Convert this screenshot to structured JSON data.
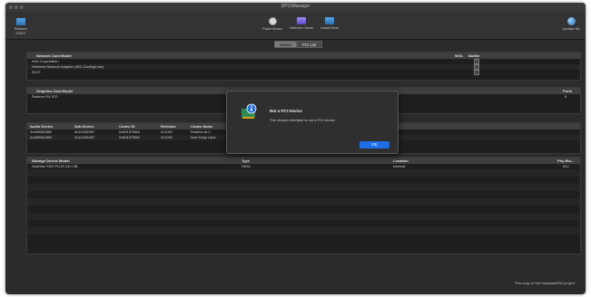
{
  "window": {
    "title": "DPCIManager"
  },
  "toolbar": {
    "left_label": "Restore DSDT",
    "items": [
      {
        "label": "Patch Notes",
        "icon": "gear-icon"
      },
      {
        "label": "Refresh Cards",
        "icon": "purple-card-icon"
      },
      {
        "label": "Install Kext",
        "icon": "blue-card-icon"
      }
    ],
    "right_label": "Update Db"
  },
  "tabs": {
    "status": "Status",
    "pci_list": "PCI List",
    "selected": "Status"
  },
  "network": {
    "headers": [
      "Network Card Model",
      "WOL",
      "Builtin"
    ],
    "rows": [
      [
        "Intel Corporation",
        "",
        ""
      ],
      [
        "Wireless Network Adapter (802.11a/b/g/n/ac)",
        "",
        ""
      ],
      [
        "Wi-Fi",
        "",
        ""
      ]
    ]
  },
  "graphics": {
    "headers": [
      "Graphics Card Model",
      "Ports"
    ],
    "rows": [
      [
        "Radeon RX 570",
        "",
        "6"
      ]
    ]
  },
  "audio": {
    "headers": [
      "Audio Device",
      "Sub Device",
      "Codec ID",
      "Revision",
      "Codec Name"
    ],
    "rows": [
      [
        "0x4B9BA36B",
        "0x104394B7",
        "0x80157B8A",
        "0x1002",
        "Realtek ALC"
      ],
      [
        "0x4B9BA36B",
        "0x104394B7",
        "0x80157B8A",
        "0x1002",
        "Intel Kaby Lake"
      ],
      [
        "",
        "",
        "",
        "",
        ""
      ]
    ]
  },
  "storage": {
    "headers": [
      "Storage Device Model",
      "Type",
      "Location",
      "Phy Blo..."
    ],
    "rows": [
      [
        "SanDisk SSD PLUS 240 GB",
        "SATA",
        "Internal",
        "512"
      ]
    ]
  },
  "footer": {
    "text": "This copy of the DatabaseRW project"
  },
  "dialog": {
    "title": "Not a PCI Device",
    "message": "The chosen interface is not a PCI device",
    "button": "OK"
  }
}
